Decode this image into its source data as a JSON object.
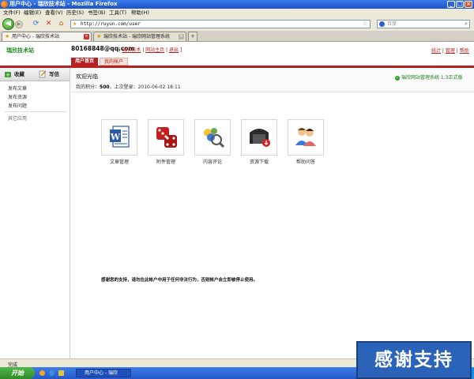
{
  "window": {
    "title": "用户中心 - 瑞欣技术站 - Mozilla Firefox",
    "minimize": "_",
    "maximize": "□",
    "close": "×"
  },
  "menubar": [
    "文件(F)",
    "编辑(E)",
    "查看(V)",
    "历史(S)",
    "书签(B)",
    "工具(T)",
    "帮助(H)"
  ],
  "navbar": {
    "url": "http://ruyun.com/user",
    "search_placeholder": "百度"
  },
  "tabs": [
    {
      "label": "用户中心 - 瑞欣技术站",
      "active": true
    },
    {
      "label": "瑞欣技术站 - 瑞欣网站管理系统",
      "active": false
    }
  ],
  "header": {
    "site_name": "瑞欣技术站",
    "user_email": "80168848@qq.com",
    "bracket_open": "[",
    "bracket_close": "]",
    "links": [
      "瑞欣技术",
      "网站主页",
      "退出"
    ],
    "right_links": [
      "统计",
      "管理",
      "帮助"
    ],
    "tabs": [
      "用户首页",
      "我的帐户"
    ]
  },
  "sidebar": {
    "actions": [
      "收藏",
      "写信"
    ],
    "items": [
      "发布文章",
      "发布资源",
      "发布问题"
    ],
    "other": "其它应用"
  },
  "main": {
    "welcome": "欢迎光临",
    "points_label": "我的积分：",
    "points_value": "500",
    "last_login_label": "，上次登录：",
    "last_login": "2010-06-02 18:11",
    "version": "瑞欣网站管理系统 1.3正式版",
    "apps": [
      {
        "label": "文章管理",
        "icon": "word-document-icon"
      },
      {
        "label": "附件管理",
        "icon": "dice-icon"
      },
      {
        "label": "内容评论",
        "icon": "comment-magnifier-icon"
      },
      {
        "label": "资源下载",
        "icon": "download-box-icon"
      },
      {
        "label": "帮助问答",
        "icon": "users-icon"
      }
    ],
    "notice": "感谢您的支持，请勿在此帐户中用于任何非法行为，否则帐户会立即被停止使用。"
  },
  "statusbar": {
    "text": "完成"
  },
  "taskbar": {
    "start": "开始",
    "item": "用户中心 - 瑞欣"
  },
  "promo": {
    "text": "感谢支持"
  },
  "colors": {
    "accent_red": "#b52020",
    "site_green": "#1f8a1f",
    "title_blue": "#2457c9"
  }
}
